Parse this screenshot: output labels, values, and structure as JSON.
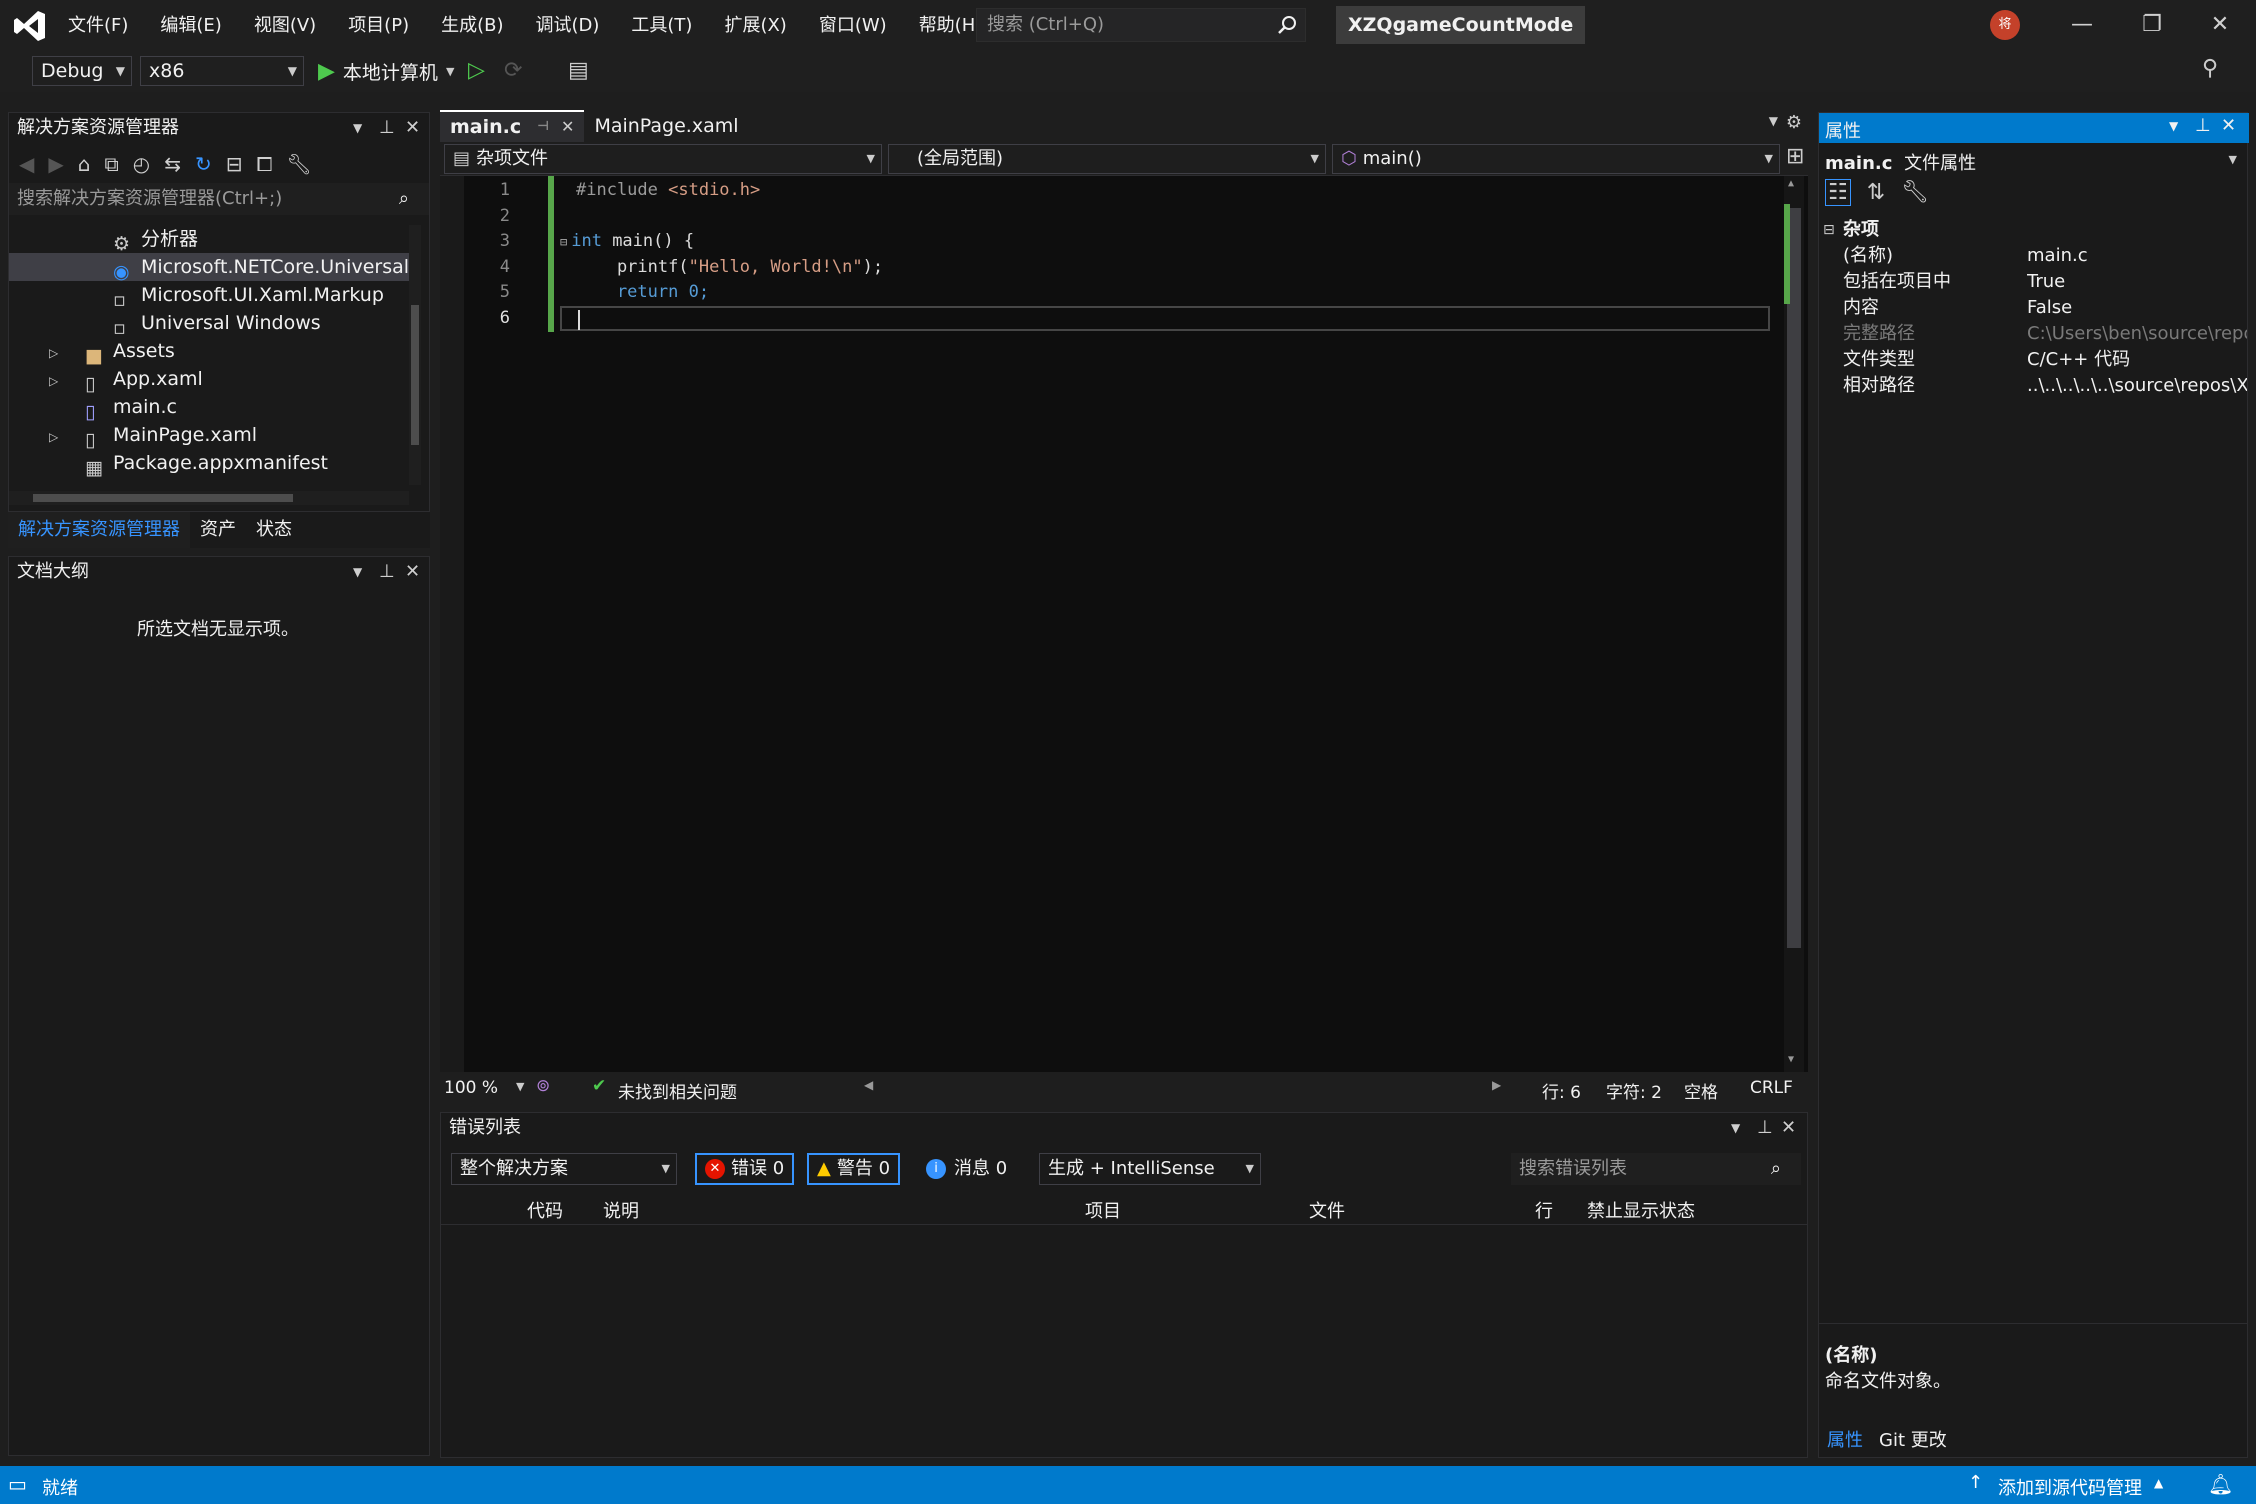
{
  "menu": [
    "文件(F)",
    "编辑(E)",
    "视图(V)",
    "项目(P)",
    "生成(B)",
    "调试(D)",
    "工具(T)",
    "扩展(X)",
    "窗口(W)",
    "帮助(H)"
  ],
  "search": {
    "placeholder": "搜索 (Ctrl+Q)"
  },
  "window_title": "XZQgameCountMode",
  "avatar_text": "将",
  "toolbar": {
    "config": "Debug",
    "platform": "x86",
    "run_label": "本地计算机"
  },
  "solution": {
    "title": "解决方案资源管理器",
    "search_placeholder": "搜索解决方案资源管理器(Ctrl+;)",
    "items": [
      {
        "label": "分析器"
      },
      {
        "label": "Microsoft.NETCore.UniversalW"
      },
      {
        "label": "Microsoft.UI.Xaml.Markup"
      },
      {
        "label": "Universal Windows"
      },
      {
        "label": "Assets"
      },
      {
        "label": "App.xaml"
      },
      {
        "label": "main.c"
      },
      {
        "label": "MainPage.xaml"
      },
      {
        "label": "Package.appxmanifest"
      }
    ],
    "tabs": [
      "解决方案资源管理器",
      "资产",
      "状态"
    ]
  },
  "outline": {
    "title": "文档大纲",
    "empty": "所选文档无显示项。"
  },
  "editor": {
    "tabs": [
      {
        "label": "main.c"
      },
      {
        "label": "MainPage.xaml"
      }
    ],
    "nav": {
      "project": "杂项文件",
      "scope": "(全局范围)",
      "member": "main()"
    },
    "lines": [
      {
        "n": "1",
        "a": "#include ",
        "b": "<stdio.h>",
        "c": ""
      },
      {
        "n": "2",
        "a": "",
        "b": "",
        "c": ""
      },
      {
        "n": "3",
        "a": "int",
        "b": " main() {",
        "c": ""
      },
      {
        "n": "4",
        "a": "    printf(",
        "b": "\"Hello, World!\\n\"",
        "c": ");"
      },
      {
        "n": "5",
        "a": "    return 0;",
        "b": "",
        "c": ""
      },
      {
        "n": "6",
        "a": "",
        "b": "",
        "c": ""
      }
    ],
    "status": {
      "zoom": "100 %",
      "issues": "未找到相关问题",
      "line": "行: 6",
      "col": "字符: 2",
      "spaces": "空格",
      "eol": "CRLF"
    }
  },
  "errorlist": {
    "title": "错误列表",
    "scope": "整个解决方案",
    "errors": "错误 0",
    "warnings": "警告 0",
    "messages": "消息 0",
    "build": "生成 + IntelliSense",
    "search_placeholder": "搜索错误列表",
    "columns": [
      "代码",
      "说明",
      "项目",
      "文件",
      "行",
      "禁止显示状态"
    ]
  },
  "props": {
    "title": "属性",
    "subject": "main.c",
    "subject_type": "文件属性",
    "section": "杂项",
    "rows": [
      {
        "k": "(名称)",
        "v": "main.c"
      },
      {
        "k": "包括在项目中",
        "v": "True"
      },
      {
        "k": "内容",
        "v": "False"
      },
      {
        "k": "完整路径",
        "v": "C:\\Users\\ben\\source\\repo"
      },
      {
        "k": "文件类型",
        "v": "C/C++ 代码"
      },
      {
        "k": "相对路径",
        "v": "..\\..\\..\\..\\..\\source\\repos\\X"
      }
    ],
    "desc_title": "(名称)",
    "desc_text": "命名文件对象。",
    "tabs": [
      "属性",
      "Git 更改"
    ]
  },
  "statusbar": {
    "left": "就绪",
    "right": "添加到源代码管理"
  },
  "colors": {
    "accent": "#007acc",
    "error": "#e51400",
    "warning": "#ffcc00",
    "info": "#3794ff"
  }
}
